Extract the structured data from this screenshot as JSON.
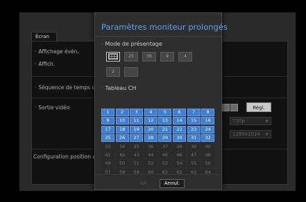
{
  "background": {
    "tab_label": "Écran",
    "items": {
      "event_display": "Affichage évén.",
      "display": "Affich.",
      "sequence_time": "Séquence de temps de",
      "video_output": "Sortie vidéo",
      "config_position": "Configuration position af"
    },
    "settings_button": "Régl.",
    "resolution_select": "720p",
    "monitor_resolution_select": "1280x1024"
  },
  "dialog": {
    "title": "Paramètres moniteur prolongés",
    "layout_section": "Mode de présentage",
    "layout_options": [
      "16",
      "25",
      "36",
      "9",
      "4",
      "2",
      ""
    ],
    "layout_selected": "16",
    "channel_section": "Tableau CH",
    "channels": [
      "1",
      "2",
      "3",
      "4",
      "5",
      "6",
      "7",
      "8",
      "9",
      "10",
      "11",
      "12",
      "13",
      "14",
      "15",
      "16",
      "17",
      "18",
      "19",
      "20",
      "21",
      "22",
      "23",
      "24",
      "25",
      "26",
      "27",
      "28",
      "29",
      "30",
      "31",
      "32",
      "33",
      "34",
      "35",
      "36",
      "37",
      "38",
      "39",
      "40",
      "41",
      "42",
      "43",
      "44",
      "45",
      "46",
      "47",
      "48",
      "49",
      "50",
      "51",
      "52",
      "53",
      "54",
      "55",
      "56",
      "57",
      "58",
      "59",
      "60",
      "61",
      "62",
      "63",
      "64"
    ],
    "channels_active_count": 32,
    "ok_label": "OK",
    "cancel_label": "Annul."
  },
  "colors": {
    "accent_title": "#5fa3e8",
    "channel_active": "#3d7fd6",
    "dialog_bg": "#2e2e2e"
  }
}
